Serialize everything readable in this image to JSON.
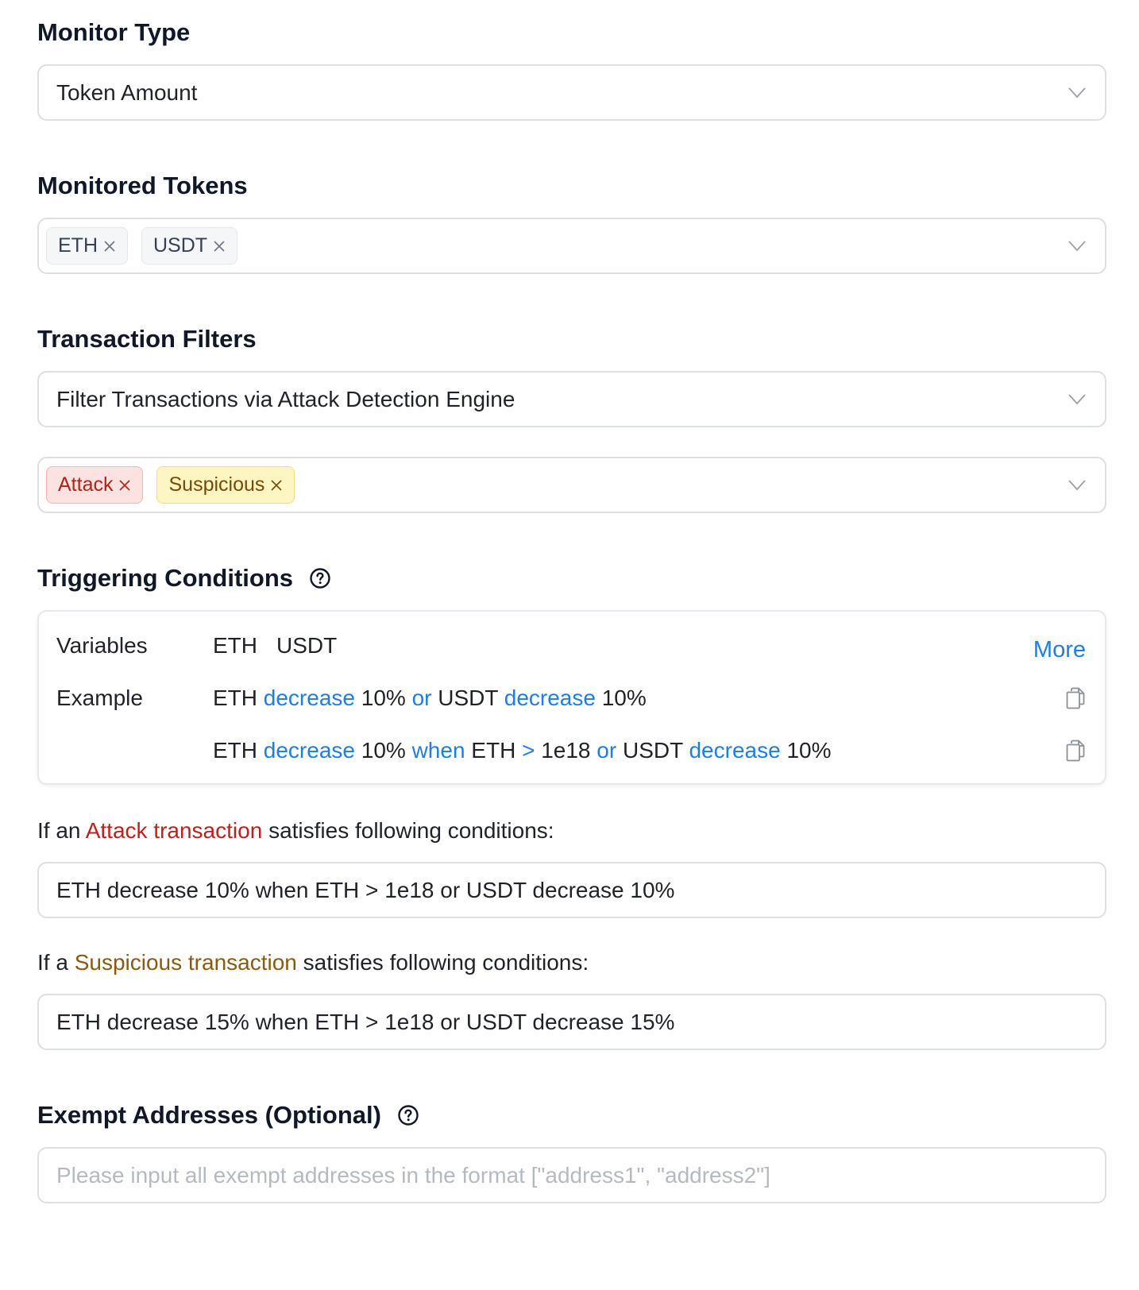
{
  "monitor_type": {
    "title": "Monitor Type",
    "value": "Token Amount"
  },
  "monitored_tokens": {
    "title": "Monitored Tokens",
    "tags": [
      "ETH",
      "USDT"
    ]
  },
  "transaction_filters": {
    "title": "Transaction Filters",
    "value": "Filter Transactions via Attack Detection Engine",
    "tags": [
      "Attack",
      "Suspicious"
    ]
  },
  "triggering_conditions": {
    "title": "Triggering Conditions",
    "variables_label": "Variables",
    "variables": [
      "ETH",
      "USDT"
    ],
    "more_link": "More",
    "example_label": "Example",
    "example1": [
      "ETH",
      "decrease",
      "10%",
      "or",
      "USDT",
      "decrease",
      "10%"
    ],
    "example2": [
      "ETH",
      "decrease",
      "10%",
      "when",
      "ETH",
      ">",
      "1e18",
      "or",
      "USDT",
      "decrease",
      "10%"
    ]
  },
  "attack_rule": {
    "prefix": "If an",
    "highlight": "Attack transaction",
    "suffix": "satisfies following conditions:",
    "value": "ETH decrease 10% when ETH > 1e18 or USDT decrease 10%"
  },
  "suspicious_rule": {
    "prefix": "If a",
    "highlight": "Suspicious transaction",
    "suffix": "satisfies following conditions:",
    "value": "ETH decrease 15% when ETH > 1e18 or USDT decrease 15%"
  },
  "exempt_addresses": {
    "title": "Exempt Addresses (Optional)",
    "placeholder": "Please input all exempt addresses in the format [\"address1\", \"address2\"]"
  },
  "colors": {
    "keyword_blue": "#1e7ee6",
    "attack_red": "#c0201c",
    "suspicious_brown": "#8a5a0f",
    "border": "#dcdfe4"
  }
}
